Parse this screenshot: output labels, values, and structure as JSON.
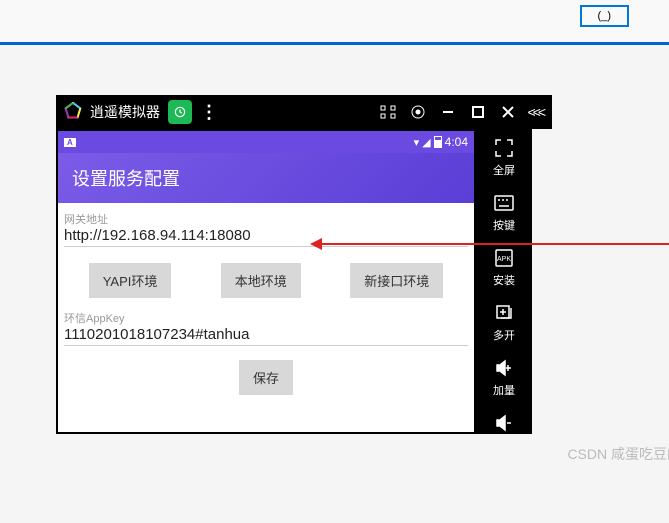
{
  "top_button": "(_)",
  "emulator": {
    "title": "逍遥模拟器",
    "chevrons": "<<<"
  },
  "status": {
    "indicator": "A",
    "time": "4:04"
  },
  "app": {
    "header_title": "设置服务配置",
    "gateway_label": "网关地址",
    "gateway_value": "http://192.168.94.114:18080",
    "buttons": {
      "yapi": "YAPI环境",
      "local": "本地环境",
      "newapi": "新接口环境",
      "save": "保存"
    },
    "appkey_label": "环信AppKey",
    "appkey_value": "1110201018107234#tanhua"
  },
  "sidebar": {
    "fullscreen": "全屏",
    "keys": "按键",
    "install": "安装",
    "multi": "多开",
    "volume_up": "加量"
  },
  "watermark": "CSDN 咸蛋吃豆的土豆"
}
